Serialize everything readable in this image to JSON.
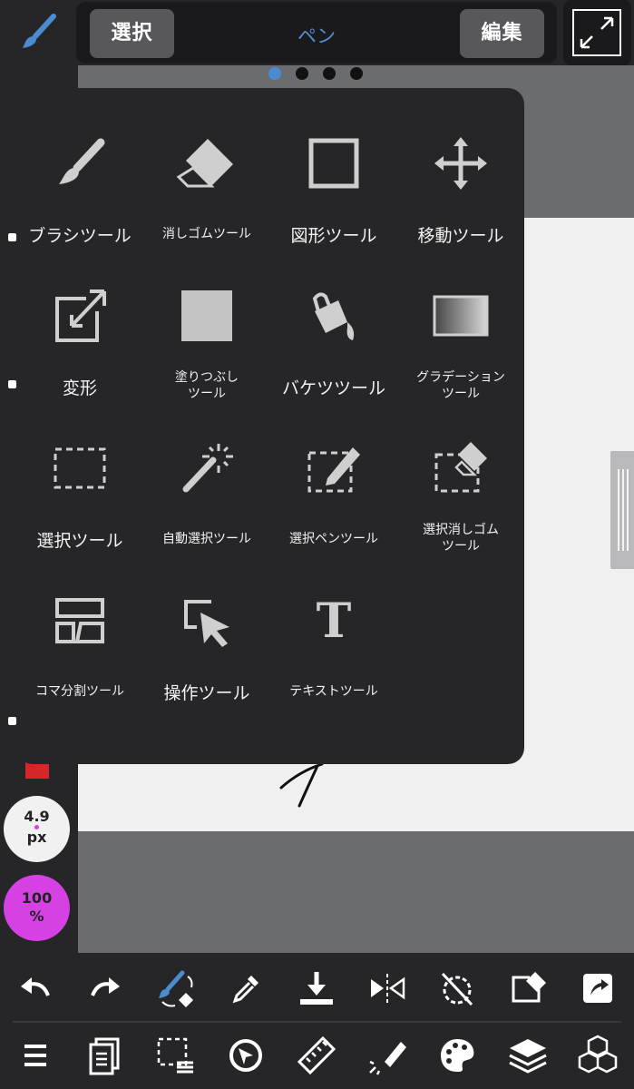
{
  "topbar": {
    "select_label": "選択",
    "mode_title": "ペン",
    "edit_label": "編集"
  },
  "brush": {
    "size_value": "4.9",
    "size_unit": "px",
    "opacity_value": "100",
    "opacity_unit": "%"
  },
  "tools": [
    {
      "label": "ブラシツール",
      "icon": "brush-icon"
    },
    {
      "label": "消しゴムツール",
      "icon": "eraser-icon"
    },
    {
      "label": "図形ツール",
      "icon": "shape-icon"
    },
    {
      "label": "移動ツール",
      "icon": "move-icon"
    },
    {
      "label": "変形",
      "icon": "transform-icon"
    },
    {
      "label": "塗りつぶし",
      "label2": "ツール",
      "icon": "fill-icon"
    },
    {
      "label": "バケツツール",
      "icon": "bucket-icon"
    },
    {
      "label": "グラデーション",
      "label2": "ツール",
      "icon": "gradient-icon"
    },
    {
      "label": "選択ツール",
      "icon": "select-icon"
    },
    {
      "label": "自動選択ツール",
      "icon": "magic-wand-icon"
    },
    {
      "label": "選択ペンツール",
      "icon": "select-pen-icon"
    },
    {
      "label": "選択消しゴム",
      "label2": "ツール",
      "icon": "select-eraser-icon"
    },
    {
      "label": "コマ分割ツール",
      "icon": "panel-divide-icon"
    },
    {
      "label": "操作ツール",
      "icon": "operation-icon"
    },
    {
      "label": "テキストツール",
      "icon": "text-icon"
    }
  ],
  "text_tool_glyph": "T",
  "colors": {
    "accent": "#4b8bd0",
    "current_color": "#d52727",
    "opacity_badge": "#d541e2"
  }
}
